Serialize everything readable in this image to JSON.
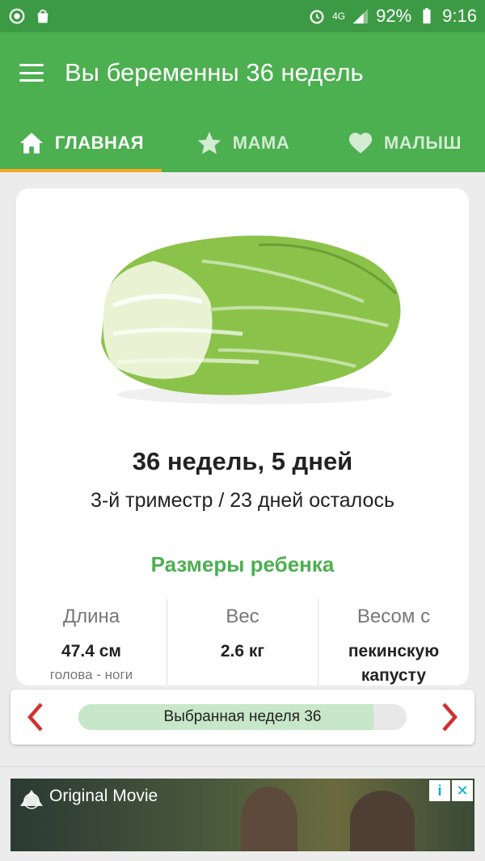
{
  "status": {
    "signal": "4G",
    "battery": "92%",
    "time": "9:16"
  },
  "appbar": {
    "title": "Вы беременны 36 недель"
  },
  "tabs": [
    {
      "label": "ГЛАВНАЯ",
      "icon": "home-icon",
      "active": true
    },
    {
      "label": "МАМА",
      "icon": "star-icon",
      "active": false
    },
    {
      "label": "МАЛЫШ",
      "icon": "heart-icon",
      "active": false
    }
  ],
  "card": {
    "week_title": "36 недель, 5 дней",
    "trimester": "3-й триместр / 23 дней осталось",
    "sizes_title": "Размеры ребенка",
    "stats": [
      {
        "label": "Длина",
        "value": "47.4 см",
        "note": "голова - ноги"
      },
      {
        "label": "Вес",
        "value": "2.6 кг",
        "note": ""
      },
      {
        "label": "Весом с",
        "value": "пекинскую капусту",
        "note": ""
      }
    ]
  },
  "week_selector": {
    "label": "Выбранная неделя 36",
    "progress": 0.9
  },
  "ad": {
    "text": "Original Movie"
  },
  "colors": {
    "primary": "#4caf50",
    "status": "#3c9a44",
    "accent": "#f5a623",
    "arrow": "#d32f2f"
  }
}
